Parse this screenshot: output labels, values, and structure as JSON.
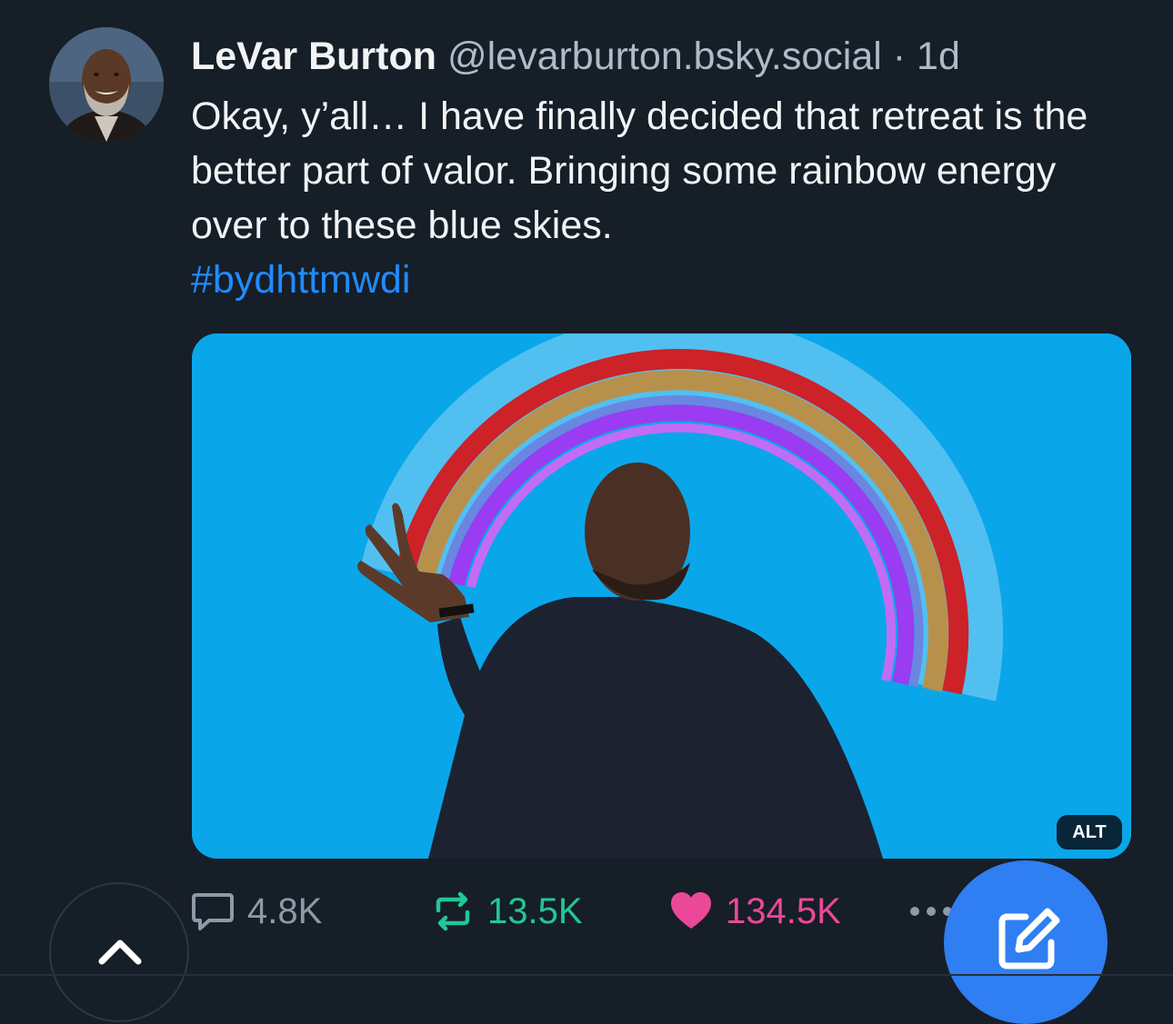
{
  "post": {
    "author": {
      "display_name": "LeVar Burton",
      "handle": "@levarburton.bsky.social",
      "separator": "·",
      "time": "1d"
    },
    "text": "Okay, y’all… I have finally decided that retreat is the better part of valor. Bringing some rainbow energy over to these blue skies.",
    "hashtag": "#bydhttmwdi",
    "media": {
      "alt_badge": "ALT"
    },
    "actions": {
      "reply_count": "4.8K",
      "repost_count": "13.5K",
      "like_count": "134.5K"
    }
  },
  "colors": {
    "background": "#161e27",
    "link": "#208bfe",
    "repost": "#22c795",
    "like": "#ec4899",
    "compose_button": "#2f7ef2",
    "media_background": "#0aa6ea"
  },
  "icons": [
    "reply-icon",
    "repost-icon",
    "heart-icon",
    "more-icon",
    "chevron-up-icon",
    "compose-icon"
  ]
}
